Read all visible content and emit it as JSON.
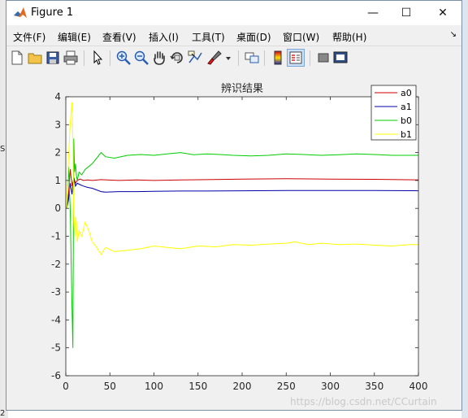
{
  "window": {
    "title": "Figure 1",
    "controls": {
      "minimize": "—",
      "maximize": "☐",
      "close": "✕"
    }
  },
  "background": {
    "left_marks": [
      "S",
      "2"
    ]
  },
  "menu": [
    {
      "label": "文件(F)"
    },
    {
      "label": "编辑(E)"
    },
    {
      "label": "查看(V)"
    },
    {
      "label": "插入(I)"
    },
    {
      "label": "工具(T)"
    },
    {
      "label": "桌面(D)"
    },
    {
      "label": "窗口(W)"
    },
    {
      "label": "帮助(H)"
    }
  ],
  "menu_dock_glyph": "↘",
  "toolbar": [
    {
      "name": "new-figure-icon"
    },
    {
      "name": "open-file-icon"
    },
    {
      "name": "save-icon"
    },
    {
      "name": "print-icon"
    },
    {
      "name": "pointer-icon"
    },
    {
      "name": "zoom-in-icon"
    },
    {
      "name": "zoom-out-icon"
    },
    {
      "name": "pan-icon"
    },
    {
      "name": "rotate-3d-icon"
    },
    {
      "name": "data-cursor-icon"
    },
    {
      "name": "brush-icon"
    },
    {
      "name": "link-plot-icon"
    },
    {
      "name": "colorbar-icon"
    },
    {
      "name": "legend-icon"
    },
    {
      "name": "hide-plot-tools-icon"
    },
    {
      "name": "show-plot-tools-icon"
    }
  ],
  "chart_data": {
    "type": "line",
    "title": "辨识结果",
    "xlabel": "",
    "ylabel": "",
    "xlim": [
      0,
      400
    ],
    "ylim": [
      -6,
      4
    ],
    "xticks": [
      0,
      50,
      100,
      150,
      200,
      250,
      300,
      350,
      400
    ],
    "yticks": [
      4,
      3,
      2,
      1,
      0,
      -1,
      -2,
      -3,
      -4,
      -5,
      -6
    ],
    "grid": false,
    "legend_position": "top-right",
    "series": [
      {
        "name": "a0",
        "color": "#cc0000",
        "x": [
          1,
          3,
          5,
          7,
          9,
          11,
          13,
          16,
          20,
          25,
          30,
          40,
          60,
          80,
          100,
          130,
          160,
          200,
          250,
          300,
          350,
          400
        ],
        "y": [
          0,
          0.5,
          1.4,
          0.8,
          1.1,
          0.9,
          1.0,
          1.05,
          1.0,
          1.02,
          1.0,
          1.03,
          1.0,
          1.02,
          1.0,
          1.02,
          1.03,
          1.05,
          1.06,
          1.05,
          1.04,
          1.02
        ]
      },
      {
        "name": "a1",
        "color": "#0000aa",
        "x": [
          1,
          3,
          5,
          7,
          9,
          11,
          13,
          16,
          20,
          25,
          30,
          40,
          45,
          60,
          80,
          100,
          130,
          160,
          200,
          250,
          300,
          350,
          400
        ],
        "y": [
          0,
          0.3,
          0.9,
          0.5,
          1.1,
          0.8,
          0.9,
          0.85,
          0.8,
          0.75,
          0.72,
          0.6,
          0.58,
          0.6,
          0.6,
          0.61,
          0.62,
          0.62,
          0.63,
          0.64,
          0.64,
          0.64,
          0.63
        ]
      },
      {
        "name": "b0",
        "color": "#00cc00",
        "x": [
          1,
          3,
          5,
          7,
          8,
          9,
          10,
          11,
          12,
          13,
          15,
          18,
          22,
          26,
          30,
          35,
          40,
          45,
          55,
          70,
          85,
          100,
          115,
          130,
          145,
          160,
          175,
          190,
          210,
          230,
          250,
          270,
          290,
          310,
          330,
          350,
          370,
          390,
          400
        ],
        "y": [
          0,
          1.5,
          0,
          -3.5,
          -5.0,
          2.5,
          1.3,
          1.6,
          1.2,
          1.0,
          1.3,
          1.2,
          1.4,
          1.5,
          1.6,
          1.8,
          2.0,
          1.85,
          1.8,
          1.9,
          1.93,
          1.9,
          1.95,
          2.0,
          1.92,
          1.95,
          1.93,
          1.9,
          1.88,
          1.9,
          1.95,
          1.93,
          1.9,
          1.92,
          1.95,
          1.93,
          1.9,
          1.9,
          1.9
        ]
      },
      {
        "name": "b1",
        "color": "#ffff00",
        "x": [
          1,
          3,
          5,
          7,
          8,
          9,
          10,
          11,
          12,
          13,
          15,
          18,
          22,
          26,
          30,
          35,
          40,
          45,
          55,
          70,
          85,
          100,
          115,
          130,
          150,
          170,
          190,
          210,
          230,
          250,
          260,
          275,
          290,
          310,
          330,
          350,
          370,
          390,
          400
        ],
        "y": [
          0,
          1.8,
          3.0,
          3.8,
          2.5,
          -0.5,
          -1.0,
          -0.3,
          -0.5,
          -1.2,
          -0.8,
          -1.0,
          -0.5,
          -0.8,
          -1.2,
          -1.4,
          -1.65,
          -1.4,
          -1.55,
          -1.5,
          -1.45,
          -1.35,
          -1.4,
          -1.45,
          -1.35,
          -1.38,
          -1.3,
          -1.32,
          -1.28,
          -1.25,
          -1.2,
          -1.3,
          -1.25,
          -1.3,
          -1.28,
          -1.32,
          -1.35,
          -1.3,
          -1.3
        ]
      }
    ]
  },
  "watermark": "https://blog.csdn.net/CCurtain"
}
